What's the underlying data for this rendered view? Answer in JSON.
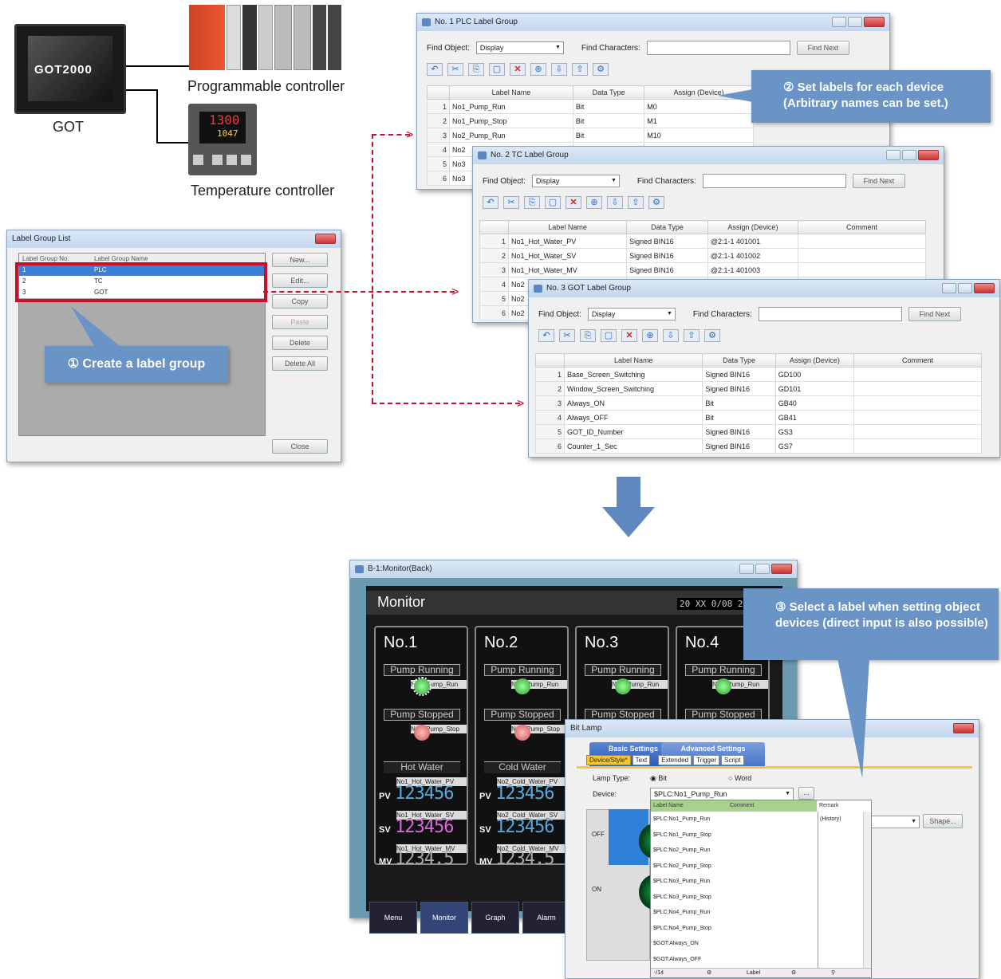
{
  "devices": {
    "got_label": "GOT",
    "got_brand": "GOT2000",
    "plc_label": "Programmable controller",
    "temp_label": "Temperature controller",
    "temp_pv": "1300",
    "temp_sv": "1047"
  },
  "label_group_list": {
    "title": "Label Group List",
    "headers": [
      "Label Group No.",
      "Label Group Name"
    ],
    "rows": [
      [
        "1",
        "PLC"
      ],
      [
        "2",
        "TC"
      ],
      [
        "3",
        "GOT"
      ]
    ],
    "buttons": [
      "New...",
      "Edit...",
      "Copy",
      "Paste",
      "Delete",
      "Delete All"
    ],
    "close": "Close"
  },
  "callout1": "① Create a label group",
  "callout2": "② Set labels for each device (Arbitrary names can be set.)",
  "callout3": "③ Select a label when setting object devices (direct input is also possible)",
  "find": {
    "object_label": "Find Object:",
    "object_value": "Display",
    "chars_label": "Find Characters:",
    "next_label": "Find Next"
  },
  "plc_group": {
    "title": "No. 1 PLC Label Group",
    "headers": [
      "Label Name",
      "Data Type",
      "Assign (Device)"
    ],
    "rows": [
      [
        "1",
        "No1_Pump_Run",
        "Bit",
        "M0"
      ],
      [
        "2",
        "No1_Pump_Stop",
        "Bit",
        "M1"
      ],
      [
        "3",
        "No2_Pump_Run",
        "Bit",
        "M10"
      ],
      [
        "4",
        "No2",
        ""
      ],
      [
        "5",
        "No3",
        ""
      ],
      [
        "6",
        "No3",
        ""
      ]
    ]
  },
  "tc_group": {
    "title": "No. 2 TC Label Group",
    "headers": [
      "Label Name",
      "Data Type",
      "Assign (Device)",
      "Comment"
    ],
    "rows": [
      [
        "1",
        "No1_Hot_Water_PV",
        "Signed BIN16",
        "@2:1-1 401001"
      ],
      [
        "2",
        "No1_Hot_Water_SV",
        "Signed BIN16",
        "@2:1-1 401002"
      ],
      [
        "3",
        "No1_Hot_Water_MV",
        "Signed BIN16",
        "@2:1-1 401003"
      ],
      [
        "4",
        "No2",
        ""
      ],
      [
        "5",
        "No2",
        ""
      ],
      [
        "6",
        "No2",
        ""
      ]
    ]
  },
  "got_group": {
    "title": "No. 3 GOT Label Group",
    "headers": [
      "Label Name",
      "Data Type",
      "Assign (Device)",
      "Comment"
    ],
    "rows": [
      [
        "1",
        "Base_Screen_Switching",
        "Signed BIN16",
        "GD100"
      ],
      [
        "2",
        "Window_Screen_Switching",
        "Signed BIN16",
        "GD101"
      ],
      [
        "3",
        "Always_ON",
        "Bit",
        "GB40"
      ],
      [
        "4",
        "Always_OFF",
        "Bit",
        "GB41"
      ],
      [
        "5",
        "GOT_ID_Number",
        "Signed BIN16",
        "GS3"
      ],
      [
        "6",
        "Counter_1_Sec",
        "Signed BIN16",
        "GS7"
      ]
    ]
  },
  "monitor": {
    "title": "B-1:Monitor(Back)",
    "header": "Monitor",
    "datetime": "20 XX 0/08 2",
    "units": [
      {
        "num": "No.1",
        "run": "Pump Running",
        "stop": "Pump Stopped",
        "run_tag": "No1_Pump_Run",
        "stop_tag": "No1_Pump_Stop",
        "water": "Hot Water",
        "pv_tag": "No1_Hot_Water_PV",
        "sv_tag": "No1_Hot_Water_SV",
        "mv_tag": "No1_Hot_Water_MV"
      },
      {
        "num": "No.2",
        "run": "Pump Running",
        "stop": "Pump Stopped",
        "run_tag": "No2_Pump_Run",
        "stop_tag": "No2_Pump_Stop",
        "water": "Cold Water",
        "pv_tag": "No2_Cold_Water_PV",
        "sv_tag": "No2_Cold_Water_SV",
        "mv_tag": "No2_Cold_Water_MV"
      },
      {
        "num": "No.3",
        "run": "Pump Running",
        "stop": "Pump Stopped",
        "run_tag": "No3_Pump_Run"
      },
      {
        "num": "No.4",
        "run": "Pump Running",
        "stop": "Pump Stopped",
        "run_tag": "No4_Pump_Run"
      }
    ],
    "pv": "PV",
    "sv": "SV",
    "mv": "MV",
    "value": "123456",
    "mv_value": "1234.5",
    "nav": [
      "Menu",
      "Monitor",
      "Graph",
      "Alarm"
    ]
  },
  "bitlamp": {
    "title": "Bit Lamp",
    "tab_basic": "Basic Settings",
    "tab_advanced": "Advanced Settings",
    "subtabs": [
      "Device/Style*",
      "Text",
      "Extended",
      "Trigger",
      "Script"
    ],
    "lamp_type_label": "Lamp Type:",
    "opt_bit": "Bit",
    "opt_word": "Word",
    "device_label": "Device:",
    "device_value": "$PLC:No1_Pump_Run",
    "headers": [
      "Label Name",
      "Comment",
      "Remark"
    ],
    "remark_value": "(History)",
    "off": "OFF",
    "on": "ON",
    "shape_btn": "Shape...",
    "labels": [
      "$PLC:No1_Pump_Run",
      "$PLC:No1_Pump_Stop",
      "$PLC:No2_Pump_Run",
      "$PLC:No2_Pump_Stop",
      "$PLC:No3_Pump_Run",
      "$PLC:No3_Pump_Stop",
      "$PLC:No4_Pump_Run",
      "$PLC:No4_Pump_Stop",
      "$GOT:Always_ON",
      "$GOT:Always_OFF"
    ],
    "footer_count": "-/14",
    "footer_label": "Label"
  }
}
